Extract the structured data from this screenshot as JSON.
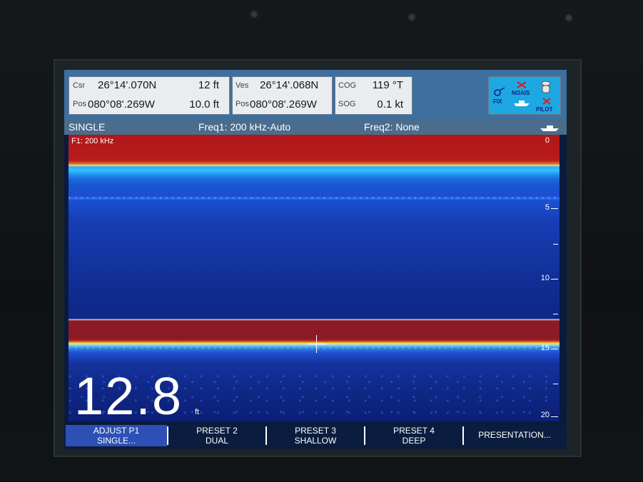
{
  "databoxes": [
    {
      "lab1": "Csr",
      "val1": "26°14'.070N",
      "unit1": "12 ft",
      "lab2": "Pos",
      "val2": "080°08'.269W",
      "unit2": "10.0 ft"
    },
    {
      "lab1": "Ves",
      "val1": "26°14'.068N",
      "lab2": "Pos",
      "val2": "080°08'.269W"
    },
    {
      "lab1": "COG",
      "val1": "119 °T",
      "lab2": "SOG",
      "val2": "0.1 kt"
    }
  ],
  "status": {
    "fix": "FIX",
    "noais": "NOAIS",
    "pilot": "PILOT"
  },
  "mode": {
    "name": "SINGLE",
    "freq1": "Freq1: 200 kHz-Auto",
    "freq2": "Freq2: None"
  },
  "sonar": {
    "channel": "F1: 200 kHz",
    "scale": [
      "0",
      "5",
      "10",
      "15",
      "20"
    ]
  },
  "depth": {
    "value": "12.8",
    "unit": "ft"
  },
  "softkeys": [
    {
      "line1": "ADJUST P1",
      "line2": "SINGLE..."
    },
    {
      "line1": "PRESET 2",
      "line2": "DUAL"
    },
    {
      "line1": "PRESET 3",
      "line2": "SHALLOW"
    },
    {
      "line1": "PRESET 4",
      "line2": "DEEP"
    },
    {
      "line1": "PRESENTATION...",
      "line2": ""
    }
  ],
  "colors": {
    "seabed": "#8b1a24",
    "surface": "#b01718",
    "water": "#12339e",
    "active_key": "#2c50b5"
  }
}
